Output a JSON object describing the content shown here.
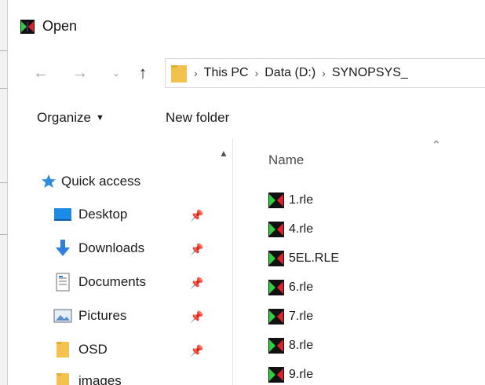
{
  "window": {
    "title": "Open"
  },
  "address": {
    "crumbs": [
      "This PC",
      "Data (D:)",
      "SYNOPSYS_"
    ]
  },
  "toolbar": {
    "organize_label": "Organize",
    "new_folder_label": "New folder"
  },
  "nav": {
    "quick_access": "Quick access",
    "items": [
      {
        "label": "Desktop",
        "pinned": true,
        "icon": "desktop-icon"
      },
      {
        "label": "Downloads",
        "pinned": true,
        "icon": "downloads-icon"
      },
      {
        "label": "Documents",
        "pinned": true,
        "icon": "documents-icon"
      },
      {
        "label": "Pictures",
        "pinned": true,
        "icon": "pictures-icon"
      },
      {
        "label": "OSD",
        "pinned": true,
        "icon": "folder-icon"
      },
      {
        "label": "images",
        "pinned": false,
        "icon": "folder-icon"
      }
    ]
  },
  "files": {
    "column_name": "Name",
    "items": [
      "1.rle",
      "4.rle",
      "5EL.RLE",
      "6.rle",
      "7.rle",
      "8.rle",
      "9.rle"
    ]
  },
  "colors": {
    "folder": "#f2c14e",
    "accent": "#0078d7",
    "app_green": "#27d23a",
    "app_red": "#e0202a"
  }
}
